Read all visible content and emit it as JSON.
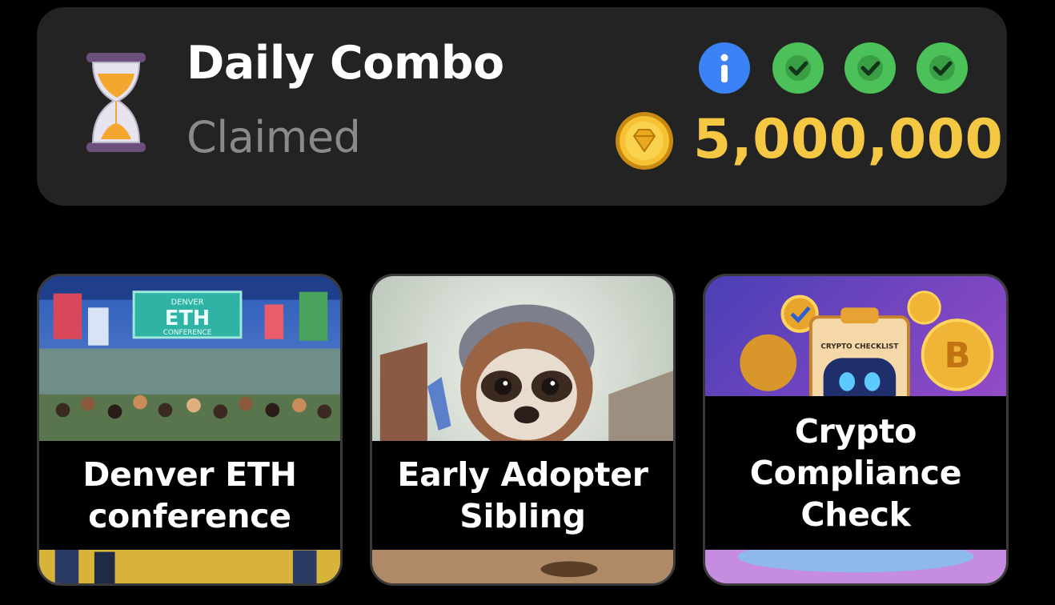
{
  "combo": {
    "title": "Daily Combo",
    "status": "Claimed",
    "reward_amount": "5,000,000",
    "status_icons": [
      "info-icon",
      "check-icon",
      "check-icon",
      "check-icon"
    ],
    "colors": {
      "panel_bg": "#232323",
      "reward": "#f4c842",
      "info": "#3b82f6",
      "check": "#4cc15a",
      "status_text": "#8a8a8a"
    }
  },
  "cards": [
    {
      "label_line1": "Denver ETH",
      "label_line2": "conference",
      "image_sign_top": "DENVER",
      "image_sign_main": "ETH",
      "image_sign_bottom": "CONFERENCE"
    },
    {
      "label_line1": "Early Adopter",
      "label_line2": "Sibling"
    },
    {
      "label_line1": "Crypto",
      "label_line2": "Compliance",
      "label_line3": "Check",
      "image_clipboard_text": "CRYPTO CHECKLIST"
    }
  ]
}
